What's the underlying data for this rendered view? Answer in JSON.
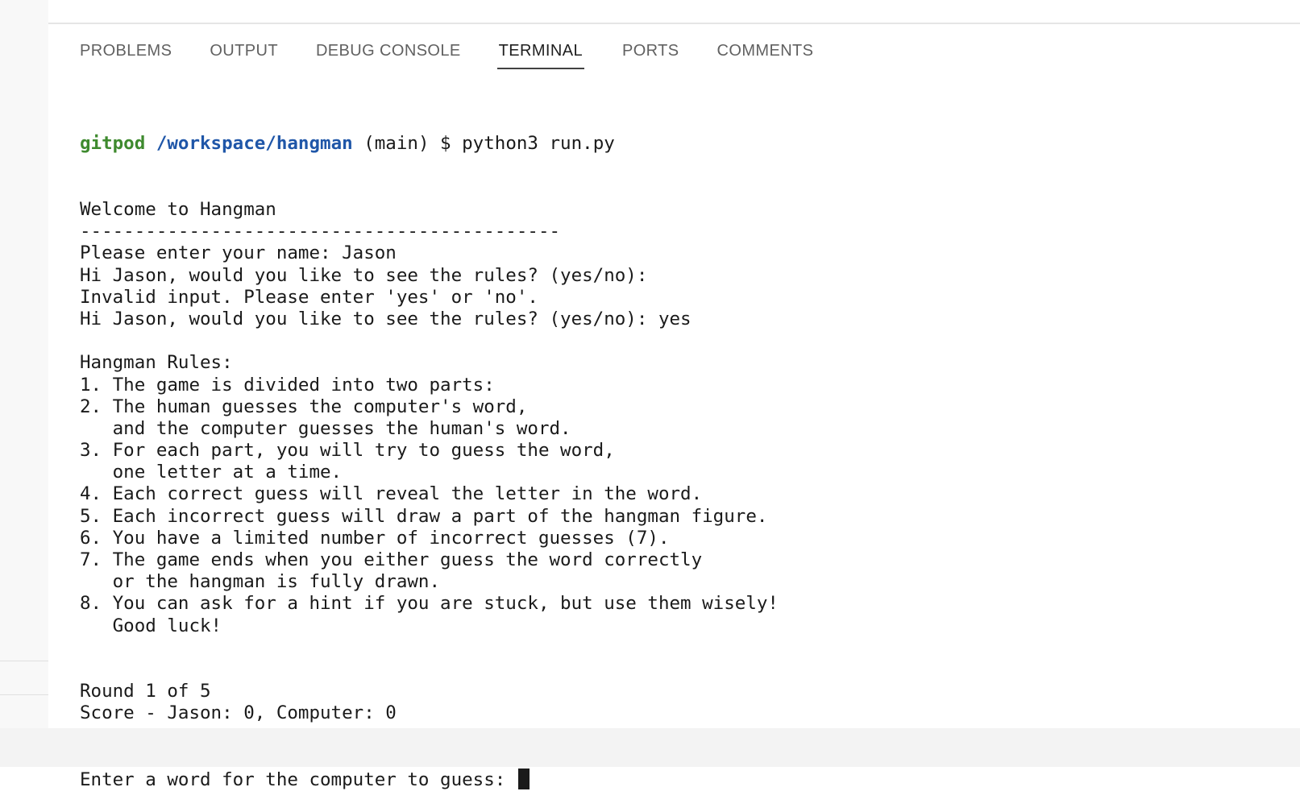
{
  "panel_tabs": [
    {
      "label": "PROBLEMS",
      "active": false
    },
    {
      "label": "OUTPUT",
      "active": false
    },
    {
      "label": "DEBUG CONSOLE",
      "active": false
    },
    {
      "label": "TERMINAL",
      "active": true
    },
    {
      "label": "PORTS",
      "active": false
    },
    {
      "label": "COMMENTS",
      "active": false
    }
  ],
  "terminal": {
    "prompt": {
      "user": "gitpod",
      "path": "/workspace/hangman",
      "branch": " (main) $ ",
      "command": "python3 run.py"
    },
    "lines": [
      "Welcome to Hangman",
      "--------------------------------------------",
      "Please enter your name: Jason",
      "Hi Jason, would you like to see the rules? (yes/no): ",
      "Invalid input. Please enter 'yes' or 'no'.",
      "Hi Jason, would you like to see the rules? (yes/no): yes",
      "",
      "Hangman Rules:",
      "1. The game is divided into two parts:",
      "2. The human guesses the computer's word,",
      "   and the computer guesses the human's word.",
      "3. For each part, you will try to guess the word,",
      "   one letter at a time.",
      "4. Each correct guess will reveal the letter in the word.",
      "5. Each incorrect guess will draw a part of the hangman figure.",
      "6. You have a limited number of incorrect guesses (7).",
      "7. The game ends when you either guess the word correctly",
      "   or the hangman is fully drawn.",
      "8. You can ask for a hint if you are stuck, but use them wisely!",
      "   Good luck!",
      "",
      "",
      "Round 1 of 5",
      "Score - Jason: 0, Computer: 0"
    ],
    "input_prompt": "Enter a word for the computer to guess: "
  },
  "colors": {
    "prompt_user": "#3e8a2e",
    "prompt_path": "#1f56a8",
    "text": "#1a1a1a"
  }
}
